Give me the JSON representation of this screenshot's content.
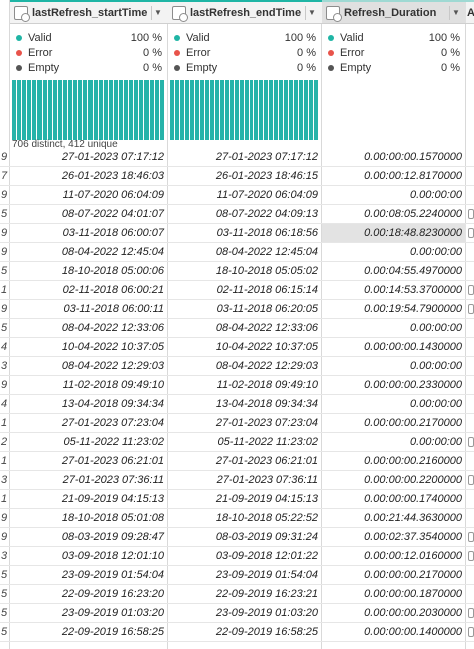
{
  "columns": [
    {
      "name": "lastRefresh_startTime",
      "selected": false
    },
    {
      "name": "lastRefresh_endTime",
      "selected": false
    },
    {
      "name": "Refresh_Duration",
      "selected": true
    },
    {
      "name": "A"
    }
  ],
  "stats": [
    {
      "valid_label": "Valid",
      "valid_pct": "100 %",
      "error_label": "Error",
      "error_pct": "0 %",
      "empty_label": "Empty",
      "empty_pct": "0 %",
      "distinct": "706 distinct, 412 unique"
    },
    {
      "valid_label": "Valid",
      "valid_pct": "100 %",
      "error_label": "Error",
      "error_pct": "0 %",
      "empty_label": "Empty",
      "empty_pct": "0 %",
      "distinct": ""
    },
    {
      "valid_label": "Valid",
      "valid_pct": "100 %",
      "error_label": "Error",
      "error_pct": "0 %",
      "empty_label": "Empty",
      "empty_pct": "0 %",
      "distinct": ""
    }
  ],
  "colors": {
    "valid": "#1fb5a5",
    "error": "#e8534a",
    "empty": "#555555",
    "bar": "#26b3a9"
  },
  "rows": [
    {
      "left": "9",
      "start": "27-01-2023 07:17:12",
      "end": "27-01-2023 07:17:12",
      "dur": "0.00:00:00.1570000"
    },
    {
      "left": "7",
      "start": "26-01-2023 18:46:03",
      "end": "26-01-2023 18:46:15",
      "dur": "0.00:00:12.8170000"
    },
    {
      "left": "9",
      "start": "11-07-2020 06:04:09",
      "end": "11-07-2020 06:04:09",
      "dur": "0.00:00:00"
    },
    {
      "left": "5",
      "start": "08-07-2022 04:01:07",
      "end": "08-07-2022 04:09:13",
      "dur": "0.00:08:05.2240000"
    },
    {
      "left": "9",
      "start": "03-11-2018 06:00:07",
      "end": "03-11-2018 06:18:56",
      "dur": "0.00:18:48.8230000"
    },
    {
      "left": "9",
      "start": "08-04-2022 12:45:04",
      "end": "08-04-2022 12:45:04",
      "dur": "0.00:00:00"
    },
    {
      "left": "5",
      "start": "18-10-2018 05:00:06",
      "end": "18-10-2018 05:05:02",
      "dur": "0.00:04:55.4970000"
    },
    {
      "left": "1",
      "start": "02-11-2018 06:00:21",
      "end": "02-11-2018 06:15:14",
      "dur": "0.00:14:53.3700000"
    },
    {
      "left": "9",
      "start": "03-11-2018 06:00:11",
      "end": "03-11-2018 06:20:05",
      "dur": "0.00:19:54.7900000"
    },
    {
      "left": "5",
      "start": "08-04-2022 12:33:06",
      "end": "08-04-2022 12:33:06",
      "dur": "0.00:00:00"
    },
    {
      "left": "4",
      "start": "10-04-2022 10:37:05",
      "end": "10-04-2022 10:37:05",
      "dur": "0.00:00:00.1430000"
    },
    {
      "left": "3",
      "start": "08-04-2022 12:29:03",
      "end": "08-04-2022 12:29:03",
      "dur": "0.00:00:00"
    },
    {
      "left": "9",
      "start": "11-02-2018 09:49:10",
      "end": "11-02-2018 09:49:10",
      "dur": "0.00:00:00.2330000"
    },
    {
      "left": "4",
      "start": "13-04-2018 09:34:34",
      "end": "13-04-2018 09:34:34",
      "dur": "0.00:00:00"
    },
    {
      "left": "1",
      "start": "27-01-2023 07:23:04",
      "end": "27-01-2023 07:23:04",
      "dur": "0.00:00:00.2170000"
    },
    {
      "left": "2",
      "start": "05-11-2022 11:23:02",
      "end": "05-11-2022 11:23:02",
      "dur": "0.00:00:00"
    },
    {
      "left": "1",
      "start": "27-01-2023 06:21:01",
      "end": "27-01-2023 06:21:01",
      "dur": "0.00:00:00.2160000"
    },
    {
      "left": "3",
      "start": "27-01-2023 07:36:11",
      "end": "27-01-2023 07:36:11",
      "dur": "0.00:00:00.2200000"
    },
    {
      "left": "1",
      "start": "21-09-2019 04:15:13",
      "end": "21-09-2019 04:15:13",
      "dur": "0.00:00:00.1740000"
    },
    {
      "left": "9",
      "start": "18-10-2018 05:01:08",
      "end": "18-10-2018 05:22:52",
      "dur": "0.00:21:44.3630000"
    },
    {
      "left": "9",
      "start": "08-03-2019 09:28:47",
      "end": "08-03-2019 09:31:24",
      "dur": "0.00:02:37.3540000"
    },
    {
      "left": "3",
      "start": "03-09-2018 12:01:10",
      "end": "03-09-2018 12:01:22",
      "dur": "0.00:00:12.0160000"
    },
    {
      "left": "5",
      "start": "23-09-2019 01:54:04",
      "end": "23-09-2019 01:54:04",
      "dur": "0.00:00:00.2170000"
    },
    {
      "left": "5",
      "start": "22-09-2019 16:23:20",
      "end": "22-09-2019 16:23:21",
      "dur": "0.00:00:00.1870000"
    },
    {
      "left": "5",
      "start": "23-09-2019 01:03:20",
      "end": "23-09-2019 01:03:20",
      "dur": "0.00:00:00.2030000"
    },
    {
      "left": "5",
      "start": "22-09-2019 16:58:25",
      "end": "22-09-2019 16:58:25",
      "dur": "0.00:00:00.1400000"
    }
  ]
}
